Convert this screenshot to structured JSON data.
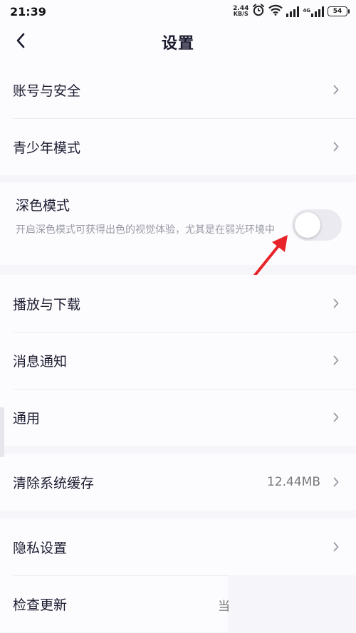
{
  "status_bar": {
    "time": "21:39",
    "net_speed_value": "2.44",
    "net_speed_unit": "KB/S",
    "network_type": "4G",
    "battery_level": "54"
  },
  "header": {
    "title": "设置"
  },
  "groups": {
    "account": {
      "items": [
        {
          "label": "账号与安全"
        },
        {
          "label": "青少年模式"
        }
      ]
    },
    "dark_mode": {
      "label": "深色模式",
      "description": "开启深色模式可获得出色的视觉体验，尤其是在弱光环境中",
      "enabled": false
    },
    "media": {
      "items": [
        {
          "label": "播放与下载"
        },
        {
          "label": "消息通知"
        },
        {
          "label": "通用"
        }
      ]
    },
    "cache": {
      "label": "清除系统缓存",
      "value": "12.44MB"
    },
    "privacy": {
      "items": [
        {
          "label": "隐私设置"
        },
        {
          "label": "检查更新",
          "value_fragment": "当"
        }
      ]
    }
  },
  "colors": {
    "page_background": "#f5f5fa",
    "card_background": "#fcfcff",
    "text_primary": "#1a1a2e",
    "text_secondary": "#9a9aa6",
    "annotation_arrow": "#e8232a"
  },
  "icons": {
    "back": "chevron-left-icon",
    "row_arrow": "chevron-right-icon"
  }
}
